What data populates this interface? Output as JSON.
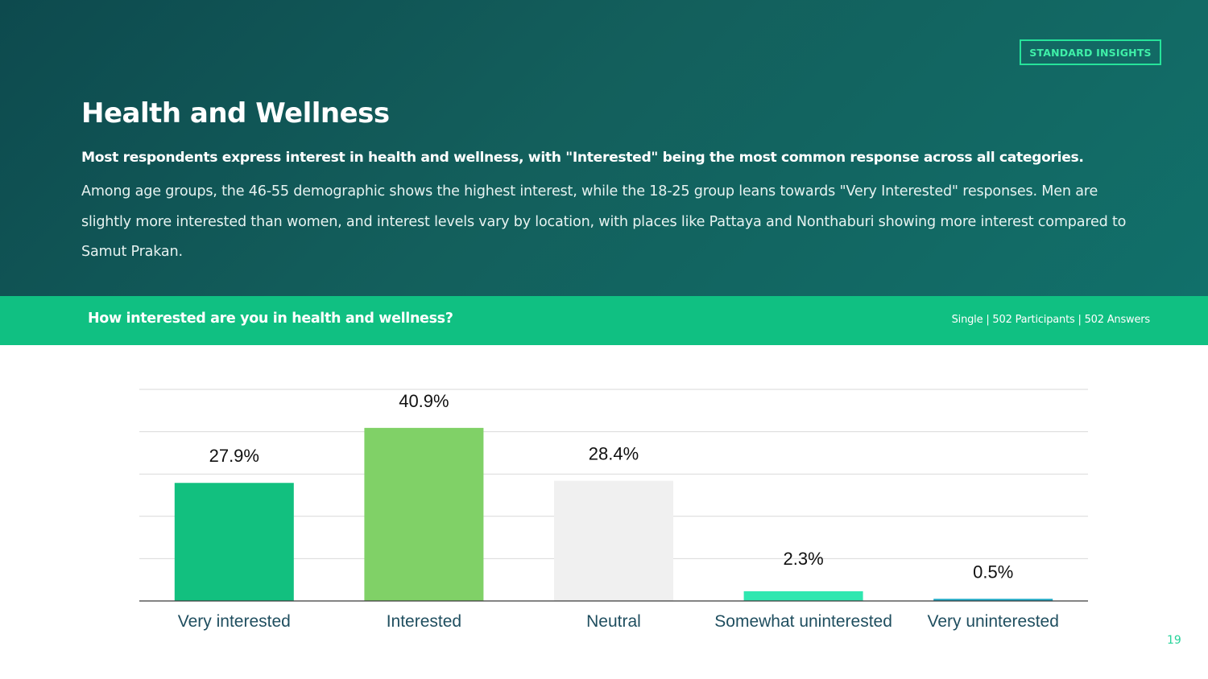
{
  "badge": "STANDARD INSIGHTS",
  "title": "Health and Wellness",
  "lead": "Most respondents express interest in health and wellness, with \"Interested\" being the most common response across all categories.",
  "body": "Among age groups, the 46-55 demographic shows the highest interest, while the 18-25 group leans towards \"Very Interested\" responses. Men are slightly more interested than women, and interest levels vary by location, with places like Pattaya and Nonthaburi showing more interest compared to Samut Prakan.",
  "question": "How interested are you in health and wellness?",
  "meta": "Single | 502 Participants | 502 Answers",
  "page_number": "19",
  "chart_data": {
    "type": "bar",
    "categories": [
      "Very interested",
      "Interested",
      "Neutral",
      "Somewhat uninterested",
      "Very uninterested"
    ],
    "values": [
      27.9,
      40.9,
      28.4,
      2.3,
      0.5
    ],
    "value_labels": [
      "27.9%",
      "40.9%",
      "28.4%",
      "2.3%",
      "0.5%"
    ],
    "colors": [
      "#12c07f",
      "#80d167",
      "#f0f0f0",
      "#2fe7b0",
      "#19a7c4"
    ],
    "ylim": [
      0,
      50
    ],
    "grid": true,
    "legend": "none",
    "title": "",
    "xlabel": "",
    "ylabel": ""
  }
}
